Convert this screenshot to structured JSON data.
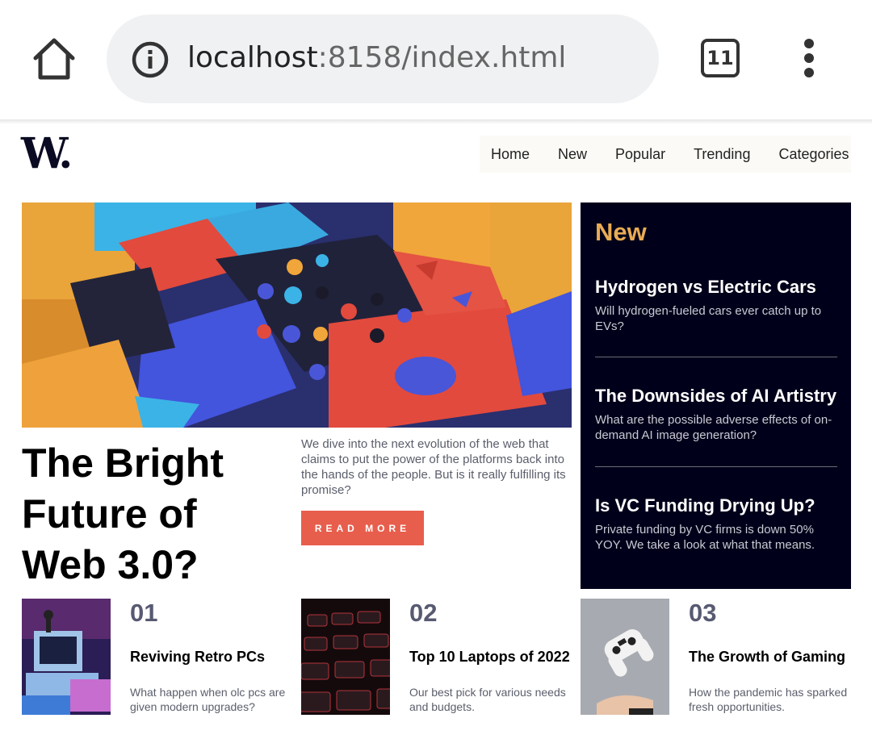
{
  "browser": {
    "url_host": "localhost",
    "url_rest": ":8158/index.html",
    "tab_count": "11"
  },
  "site": {
    "logo": "W.",
    "nav": [
      "Home",
      "New",
      "Popular",
      "Trending",
      "Categories"
    ]
  },
  "hero": {
    "title": "The Bright Future of Web 3.0?",
    "description": "We dive into the next evolution of the web that claims to put the power of the platforms back into the hands of the people. But is it really fulfilling its promise?",
    "button": "READ MORE"
  },
  "new_panel": {
    "heading": "New",
    "items": [
      {
        "title": "Hydrogen vs Electric Cars",
        "text": "Will hydrogen-fueled cars ever catch up to EVs?"
      },
      {
        "title": "The Downsides of AI Artistry",
        "text": "What are the possible adverse effects of on-demand AI image generation?"
      },
      {
        "title": "Is VC Funding Drying Up?",
        "text": "Private funding by VC firms is down 50% YOY. We take a look at what that means."
      }
    ]
  },
  "cards": [
    {
      "number": "01",
      "title": "Reviving Retro PCs",
      "text": "What happen when olc pcs are given modern upgrades?"
    },
    {
      "number": "02",
      "title": "Top 10 Laptops of 2022",
      "text": "Our best pick for various needs and budgets."
    },
    {
      "number": "03",
      "title": "The Growth of Gaming",
      "text": "How the pandemic has sparked fresh opportunities."
    }
  ],
  "colors": {
    "accent": "#e85e4c",
    "panel_bg": "#00001a",
    "panel_heading": "#e9ab53"
  }
}
